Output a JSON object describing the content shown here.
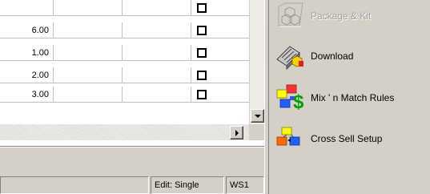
{
  "grid": {
    "rows": [
      {
        "qty": "",
        "checked": false
      },
      {
        "qty": "6.00",
        "checked": false
      },
      {
        "qty": "1.00",
        "checked": false
      },
      {
        "qty": "2.00",
        "checked": false
      },
      {
        "qty": "3.00",
        "checked": false
      }
    ]
  },
  "statusbar": {
    "panel1": "",
    "edit_mode": "Edit: Single",
    "workstation": "WS1"
  },
  "actions": [
    {
      "label": "Package & Kit",
      "icon": "package-kit-icon",
      "enabled": false
    },
    {
      "label": "Download",
      "icon": "download-icon",
      "enabled": true
    },
    {
      "label": "Mix ' n Match Rules",
      "icon": "mix-n-match-icon",
      "enabled": true
    },
    {
      "label": "Cross Sell Setup",
      "icon": "cross-sell-icon",
      "enabled": true
    }
  ],
  "colors": {
    "face": "#d4d0c8",
    "grid_line": "#c0c0c0",
    "money_green": "#00a000"
  }
}
